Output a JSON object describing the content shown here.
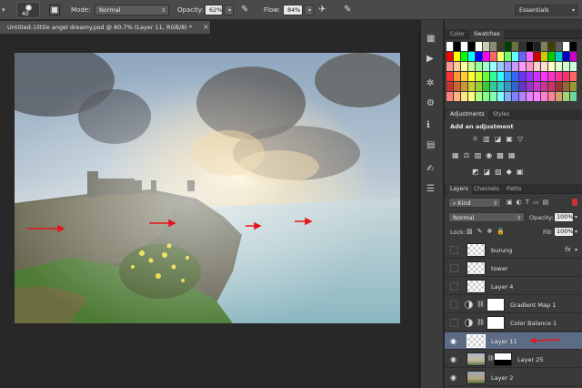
{
  "options_bar": {
    "brush_size": "40",
    "mode_label": "Mode:",
    "mode_value": "Normal",
    "opacity_label": "Opacity:",
    "opacity_value": "62%",
    "flow_label": "Flow:",
    "flow_value": "84%",
    "workspace": "Essentials"
  },
  "document": {
    "tab_title": "Untitled-1little angel dreamy.psd @ 80.7% (Layer 11, RGB/8) *",
    "close_glyph": "×"
  },
  "panels": {
    "color_tabs": [
      "Color",
      "Swatches"
    ],
    "adjustment_tabs": [
      "Adjustments",
      "Styles"
    ],
    "add_adjustment": "Add an adjustment",
    "layer_tabs": [
      "Layers",
      "Channels",
      "Paths"
    ],
    "kind_label": "Kind",
    "blend_mode": "Normal",
    "opacity_label": "Opacity:",
    "opacity_value": "100%",
    "lock_label": "Lock:",
    "fill_label": "Fill:",
    "fill_value": "100%"
  },
  "layers": [
    {
      "name": "burung",
      "visible": false,
      "fx": "fx"
    },
    {
      "name": "tower",
      "visible": false
    },
    {
      "name": "Layer 4",
      "visible": false
    },
    {
      "name": "Gradient Map 1",
      "visible": false,
      "adjustment": true
    },
    {
      "name": "Color Balance 1",
      "visible": false,
      "adjustment": true
    },
    {
      "name": "Layer 11",
      "visible": true,
      "selected": true
    },
    {
      "name": "Layer 25",
      "visible": true
    },
    {
      "name": "Layer 2",
      "visible": true
    }
  ],
  "colors": {
    "accent_arrow": "#e3161b",
    "selected_row": "#5c6c85"
  },
  "swatch_colors": [
    "#ffffff",
    "#000000",
    "#ffffff",
    "#000000",
    "#fffff0",
    "#cdcdb4",
    "#8b8b7a",
    "#3c3c2c",
    "#004000",
    "#6f6f3e",
    "#303030",
    "#000000",
    "#202020",
    "#808060",
    "#404000",
    "#5a5a5a",
    "#ffffff",
    "#000000",
    "#ff0000",
    "#ffff00",
    "#00ff00",
    "#00ffff",
    "#0000ff",
    "#ff00ff",
    "#ff6666",
    "#ffff66",
    "#66ff66",
    "#66ffff",
    "#6666ff",
    "#ff66ff",
    "#cc0000",
    "#cccc00",
    "#00cc00",
    "#00cccc",
    "#0000cc",
    "#cc00cc",
    "#ff9999",
    "#ffcc99",
    "#ffff99",
    "#ccff99",
    "#99ff99",
    "#99ffcc",
    "#99ffff",
    "#99ccff",
    "#9999ff",
    "#cc99ff",
    "#ff99ff",
    "#ff99cc",
    "#ffcccc",
    "#ffe0cc",
    "#ffffcc",
    "#e0ffcc",
    "#ccffcc",
    "#ccffe0",
    "#ff3333",
    "#ff9933",
    "#ffcc33",
    "#ffff33",
    "#ccff33",
    "#66ff33",
    "#33ff99",
    "#33ffff",
    "#3399ff",
    "#3366ff",
    "#6633ff",
    "#9933ff",
    "#cc33ff",
    "#ff33ff",
    "#ff33cc",
    "#ff3399",
    "#ff3366",
    "#ff6666",
    "#cc3333",
    "#cc6633",
    "#cc9933",
    "#cccc33",
    "#99cc33",
    "#33cc33",
    "#33cc99",
    "#33cccc",
    "#3399cc",
    "#3366cc",
    "#6633cc",
    "#9933cc",
    "#cc33cc",
    "#cc3399",
    "#cc3366",
    "#993333",
    "#996633",
    "#999933",
    "#ff8080",
    "#ffb380",
    "#ffe680",
    "#ffff80",
    "#b3ff80",
    "#80ff80",
    "#80ffb3",
    "#80ffff",
    "#80b3ff",
    "#8080ff",
    "#b380ff",
    "#e680ff",
    "#ff80ff",
    "#ff80cc",
    "#ff8099",
    "#d4a070",
    "#a0d470",
    "#70d4a0"
  ]
}
